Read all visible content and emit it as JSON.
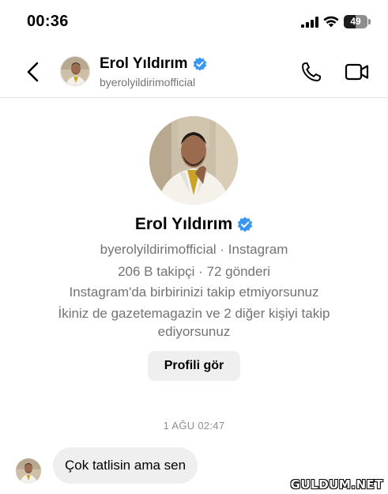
{
  "status_bar": {
    "time": "00:36",
    "battery": "49",
    "battery_level": 0.49
  },
  "header": {
    "name": "Erol Yıldırım",
    "handle": "byerolyildirimofficial",
    "back_icon": "chevron-left-icon",
    "call_icon": "phone-icon",
    "video_icon": "video-camera-icon",
    "verified_icon": "verified-badge-icon"
  },
  "profile": {
    "name": "Erol Yıldırım",
    "handle_line": "byerolyildirimofficial · Instagram",
    "stats": "206 B takipçi · 72 gönderi",
    "follow_status": "Instagram'da birbirinizi takip etmiyorsunuz",
    "mutual_line1": "İkiniz de gazetemagazin ve 2 diğer kişiyi takip",
    "mutual_line2": "ediyorsunuz",
    "view_profile_label": "Profili gör"
  },
  "conversation": {
    "timestamp": "1 AĞU 02:47",
    "messages": [
      {
        "text": "Çok tatlisin ama sen"
      }
    ]
  },
  "watermark": "GULDUM.NET",
  "colors": {
    "verified": "#3897f0",
    "secondary_text": "#737373",
    "bubble": "#efefef"
  }
}
